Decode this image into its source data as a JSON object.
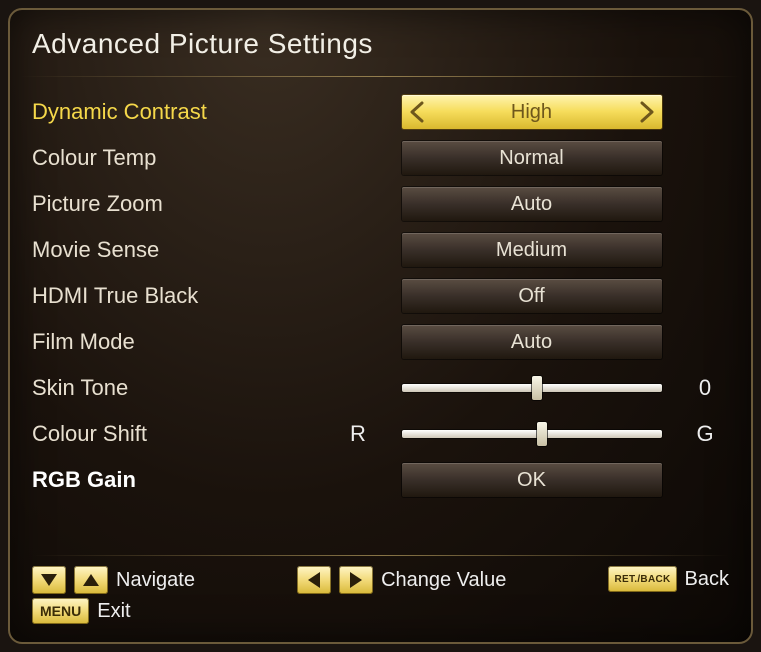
{
  "title": "Advanced Picture Settings",
  "rows": [
    {
      "key": "dynamic_contrast",
      "label": "Dynamic Contrast",
      "type": "select",
      "value": "High",
      "selected": true
    },
    {
      "key": "colour_temp",
      "label": "Colour Temp",
      "type": "select",
      "value": "Normal"
    },
    {
      "key": "picture_zoom",
      "label": "Picture Zoom",
      "type": "select",
      "value": "Auto"
    },
    {
      "key": "movie_sense",
      "label": "Movie Sense",
      "type": "select",
      "value": "Medium"
    },
    {
      "key": "hdmi_true_black",
      "label": "HDMI True Black",
      "type": "select",
      "value": "Off"
    },
    {
      "key": "film_mode",
      "label": "Film Mode",
      "type": "select",
      "value": "Auto"
    },
    {
      "key": "skin_tone",
      "label": "Skin Tone",
      "type": "slider",
      "value": 0.52,
      "right_label": "0"
    },
    {
      "key": "colour_shift",
      "label": "Colour Shift",
      "type": "slider",
      "value": 0.54,
      "left_label": "R",
      "right_label": "G"
    },
    {
      "key": "rgb_gain",
      "label": "RGB Gain",
      "type": "button",
      "value": "OK",
      "bold": true
    }
  ],
  "footer": {
    "navigate": "Navigate",
    "change_value": "Change Value",
    "back": "Back",
    "menu": "MENU",
    "retback": "RET./BACK",
    "exit": "Exit"
  }
}
